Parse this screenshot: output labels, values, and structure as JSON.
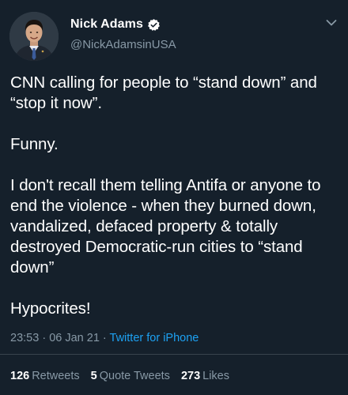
{
  "author": {
    "display_name": "Nick Adams",
    "handle": "@NickAdamsinUSA",
    "verified_icon": "verified-badge-icon",
    "avatar": "avatar-photo"
  },
  "menu": {
    "icon": "chevron-down-icon"
  },
  "tweet": {
    "paragraphs": [
      "CNN calling for people to “stand down” and “stop it now”.",
      "Funny.",
      "I don't recall them telling Antifa or anyone to end the violence - when they burned down, vandalized, defaced property & totally destroyed Democratic-run cities to “stand down”",
      "Hypocrites!"
    ],
    "time": "23:53",
    "date": "06 Jan 21",
    "source": "Twitter for iPhone",
    "separator": "·"
  },
  "stats": {
    "retweets_count": "126",
    "retweets_label": "Retweets",
    "quotes_count": "5",
    "quotes_label": "Quote Tweets",
    "likes_count": "273",
    "likes_label": "Likes"
  },
  "colors": {
    "background": "#15202b",
    "text_primary": "#ffffff",
    "text_secondary": "#8899a6",
    "accent": "#1da1f2",
    "divider": "#38444d"
  }
}
